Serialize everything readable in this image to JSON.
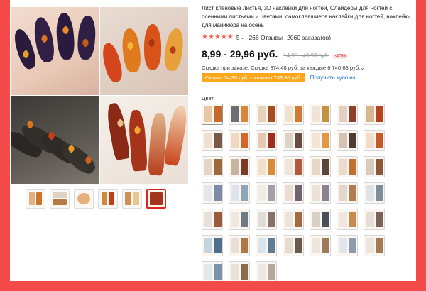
{
  "product": {
    "title": "Лист кленовые листья, 3D наклейки для ногтей, Слайдеры для ногтей с осенними листьями и цветами, самоклеящиеся наклейки для ногтей, наклейки для маникюра на осень",
    "rating_count": "5",
    "reviews": "266 Отзывы",
    "orders": "2060 заказа(ов)",
    "price": "8,99 - 29,96 руб.",
    "old_price": "14,98 - 49,93 руб.",
    "discount": "-40%",
    "bulk_discount": "Скидка при заказе: Скидка 374,48 руб. за каждые 6 740,68 руб.",
    "coupon": "Скидка 74,90 руб. с каждых 748,96 руб.",
    "get_coupons": "Получить купоны",
    "color_label": "Цвет:"
  },
  "icons": {
    "star": "star-icon",
    "chevron": "chevron-down-icon"
  },
  "colors": {
    "accent": "#e2231a",
    "star": "#f55e4e",
    "coupon_bg": "#ffa71a",
    "link": "#2e7bd6",
    "border": "#f44a4a"
  },
  "gallery": {
    "photos": [
      "dark-purple-nails-with-maple-leaves",
      "orange-nails-with-maple-leaves",
      "dark-nails-with-orange-leaves",
      "red-nails-with-autumn-leaves"
    ],
    "thumbnails_count": 6,
    "selected_thumbnail": 6
  },
  "swatches_count": 45,
  "selected_swatch": 1
}
